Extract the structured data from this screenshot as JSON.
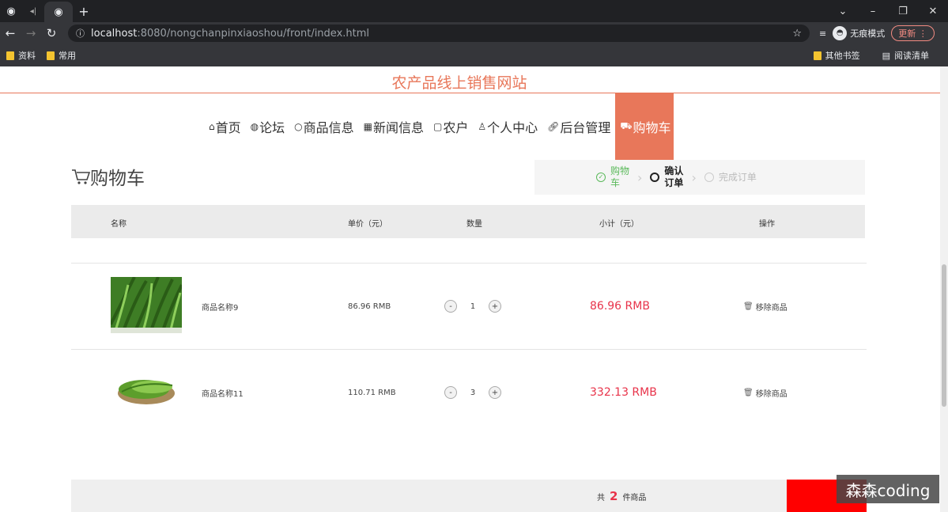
{
  "browser": {
    "url_host": "localhost",
    "url_path": ":8080/nongchanpinxiaoshou/front/index.html",
    "incognito_label": "无痕模式",
    "update_label": "更新",
    "bookmarks": [
      "资料",
      "常用"
    ],
    "bookmarks_right": [
      "其他书签",
      "阅读清单"
    ]
  },
  "site": {
    "title": "农产品线上销售网站",
    "nav": [
      {
        "label": "首页",
        "icon": "home-icon"
      },
      {
        "label": "论坛",
        "icon": "globe-icon"
      },
      {
        "label": "商品信息",
        "icon": "circle-icon"
      },
      {
        "label": "新闻信息",
        "icon": "grid-icon"
      },
      {
        "label": "农户",
        "icon": "square-icon"
      },
      {
        "label": "个人中心",
        "icon": "user-icon"
      },
      {
        "label": "后台管理",
        "icon": "link-icon"
      },
      {
        "label": "购物车",
        "icon": "cart-icon",
        "active": true
      }
    ]
  },
  "cart": {
    "heading": "购物车",
    "steps": [
      {
        "label": "购物\n车",
        "state": "done"
      },
      {
        "label": "确认\n订单",
        "state": "current"
      },
      {
        "label": "完成订单",
        "state": "todo"
      }
    ],
    "columns": [
      "名称",
      "单价（元）",
      "数量",
      "小计（元）",
      "操作"
    ],
    "items": [
      {
        "name": "商品名称9",
        "price": "86.96 RMB",
        "qty": "1",
        "subtotal": "86.96 RMB",
        "remove": "移除商品"
      },
      {
        "name": "商品名称11",
        "price": "110.71 RMB",
        "qty": "3",
        "subtotal": "332.13 RMB",
        "remove": "移除商品"
      }
    ],
    "minus": "-",
    "plus": "+",
    "summary_prefix": "共",
    "summary_count": "2",
    "summary_suffix": "件商品"
  },
  "watermark": "森森coding",
  "colors": {
    "accent": "#e8775a",
    "price": "#e8334a",
    "step_done": "#5ab95a"
  }
}
